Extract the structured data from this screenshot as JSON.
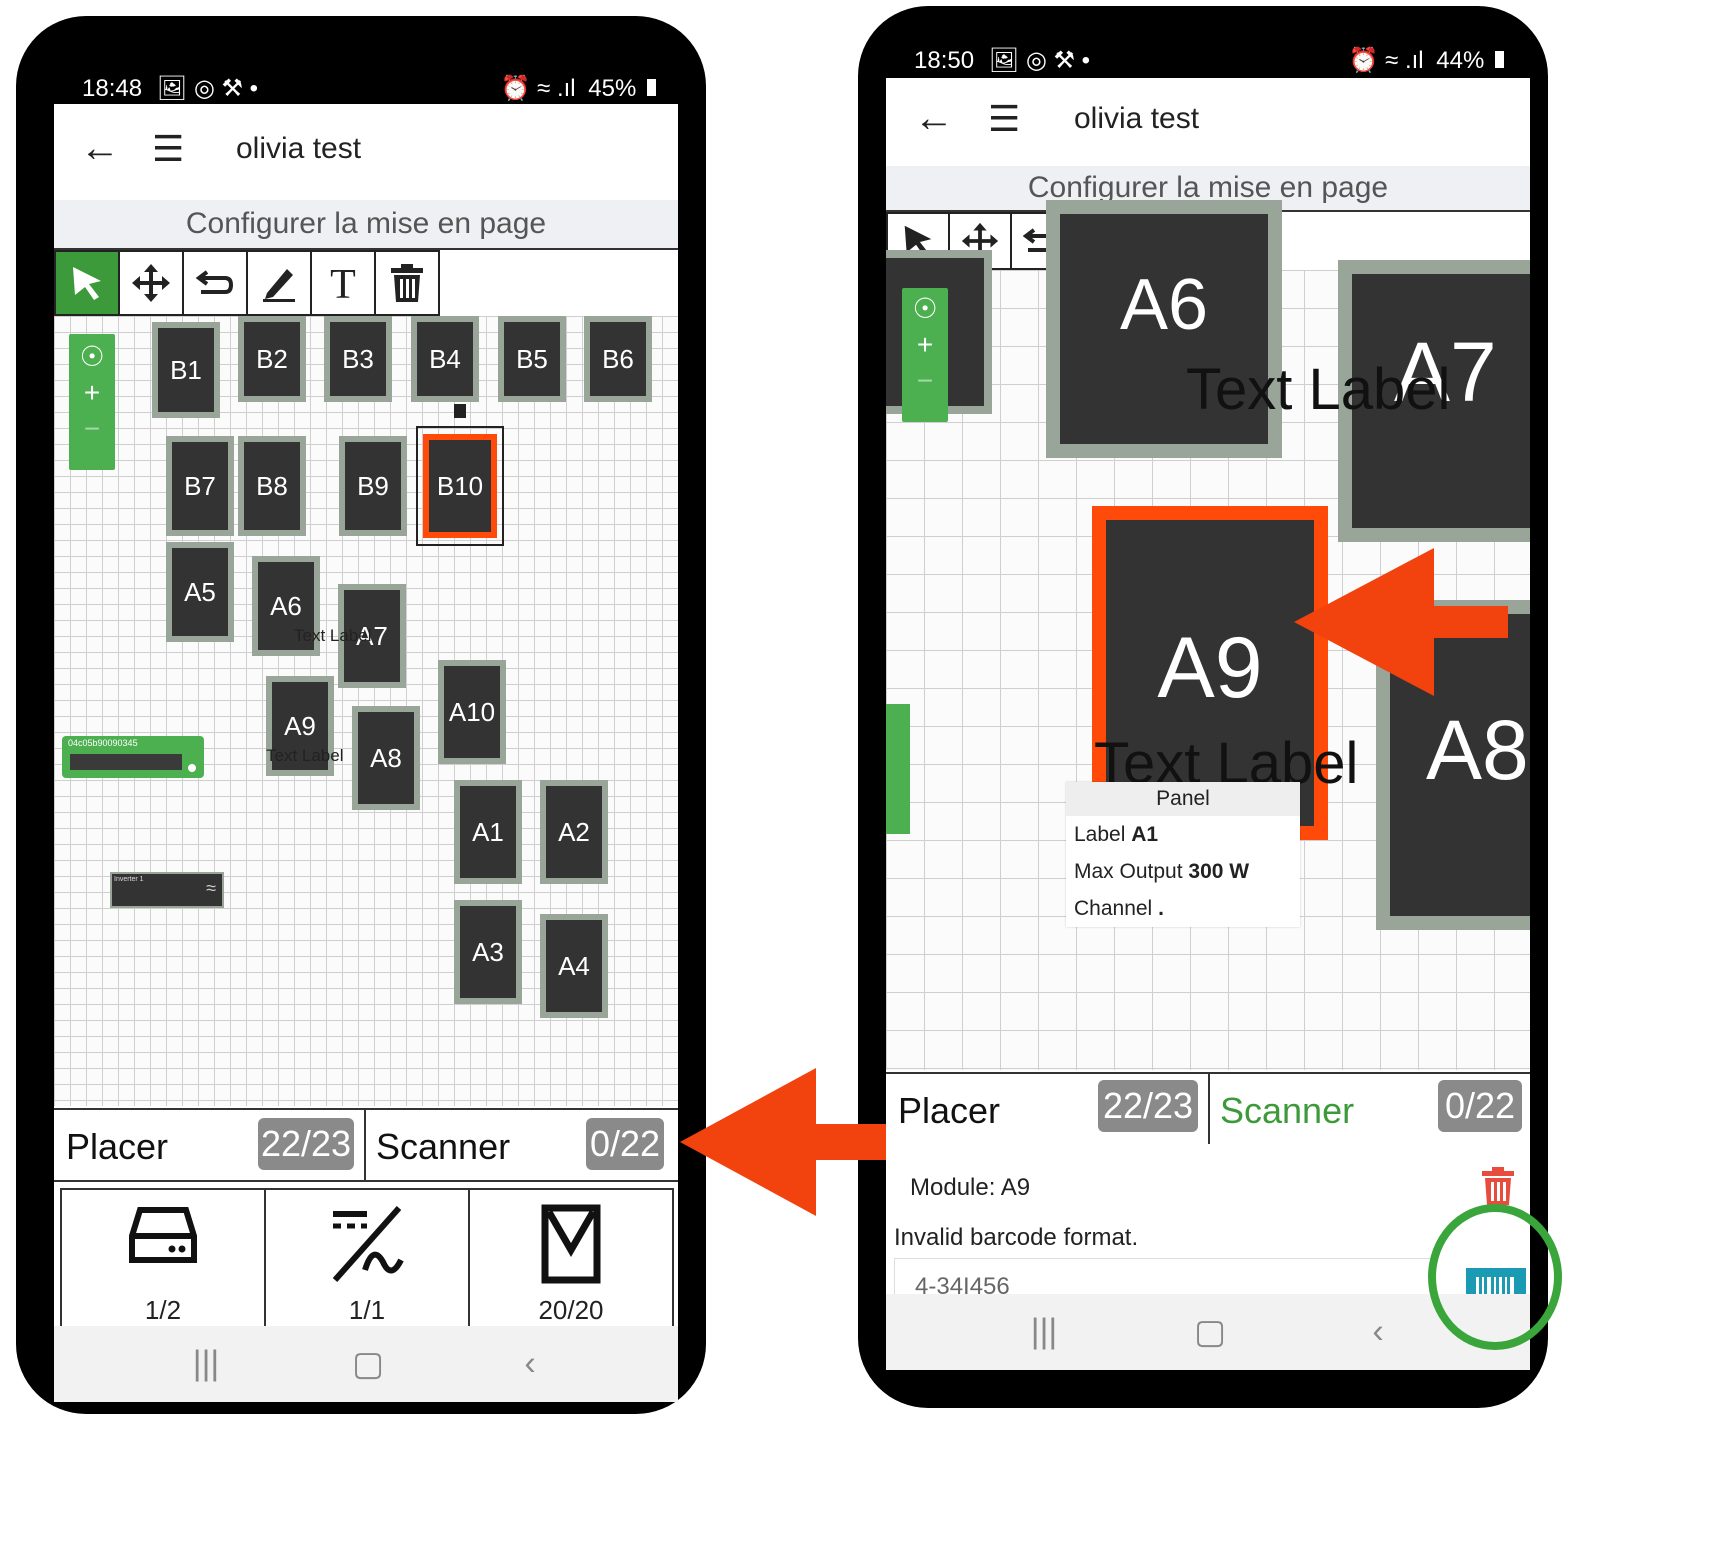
{
  "colors": {
    "accent_green": "#3d9a3a",
    "selection_orange": "#ff4a0a",
    "arrow_orange": "#f2420e",
    "circle_green": "#3aa53a",
    "badge_grey": "#8a8a8a",
    "scan_teal": "#1a9bb3",
    "delete_red": "#e74c3c"
  },
  "left": {
    "status": {
      "time": "18:48",
      "left_icons": "🖼 ◎ ⚒ •",
      "right_icons": "⏰ ≈ .ıl",
      "battery": "45%"
    },
    "appbar": {
      "back_icon": "arrow-left-icon",
      "menu_icon": "hamburger-icon",
      "title": "olivia test"
    },
    "subbar": "Configurer la mise en page",
    "modules": [
      "B1",
      "B2",
      "B3",
      "B4",
      "B5",
      "B6",
      "B7",
      "B8",
      "B9",
      "B10",
      "A5",
      "A6",
      "A7",
      "A9",
      "A8",
      "A10",
      "A1",
      "A2",
      "A3",
      "A4"
    ],
    "text_labels": [
      "Text Label",
      "Text Label"
    ],
    "device_label": "04c05b90090345",
    "inverter_label": "Inverter 1",
    "tabs": {
      "place": "Placer",
      "place_count": "22/23",
      "scan": "Scanner",
      "scan_count": "0/22"
    },
    "summary": {
      "inverter": "1/2",
      "optimizer": "1/1",
      "panel": "20/20"
    }
  },
  "right": {
    "status": {
      "time": "18:50",
      "left_icons": "🖼 ◎ ⚒ •",
      "right_icons": "⏰ ≈ .ıl",
      "battery": "44%"
    },
    "appbar": {
      "back_icon": "arrow-left-icon",
      "menu_icon": "hamburger-icon",
      "title": "olivia test"
    },
    "subbar": "Configurer la mise en page",
    "modules": [
      "A6",
      "A7",
      "A9",
      "A8"
    ],
    "text_labels": [
      "Text Label",
      "Text Label"
    ],
    "popup": {
      "header": "Panel",
      "label_key": "Label",
      "label_val": "A1",
      "max_key": "Max Output",
      "max_val": "300 W",
      "channel_key": "Channel",
      "channel_val": "."
    },
    "tabs": {
      "place": "Placer",
      "place_count": "22/23",
      "scan": "Scanner",
      "scan_count": "0/22"
    },
    "detail": {
      "module": "Module: A9",
      "error": "Invalid barcode format.",
      "barcode_value": "4-34I456"
    }
  }
}
